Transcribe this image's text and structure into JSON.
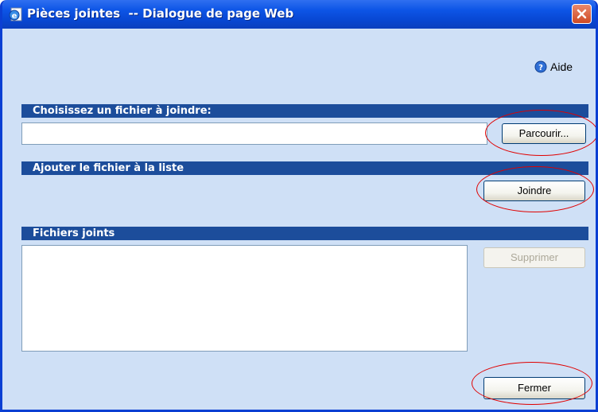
{
  "window": {
    "title": "Pièces jointes  -- Dialogue de page Web"
  },
  "help": {
    "label": "Aide"
  },
  "sections": {
    "choose_file": "Choisissez un fichier à joindre:",
    "add_to_list": "Ajouter le fichier à la liste",
    "attached_files": "Fichiers joints"
  },
  "buttons": {
    "browse": "Parcourir...",
    "attach": "Joindre",
    "delete": "Supprimer",
    "close": "Fermer"
  },
  "file_input": {
    "value": ""
  },
  "attached_list": [],
  "colors": {
    "titlebar": "#0d55e6",
    "section_bar": "#1c4d9b",
    "dialog_background": "#cfe0f6",
    "annotation": "#e00000"
  },
  "icons": {
    "title": "ie-page-icon",
    "close": "close-icon",
    "help": "help-icon"
  }
}
